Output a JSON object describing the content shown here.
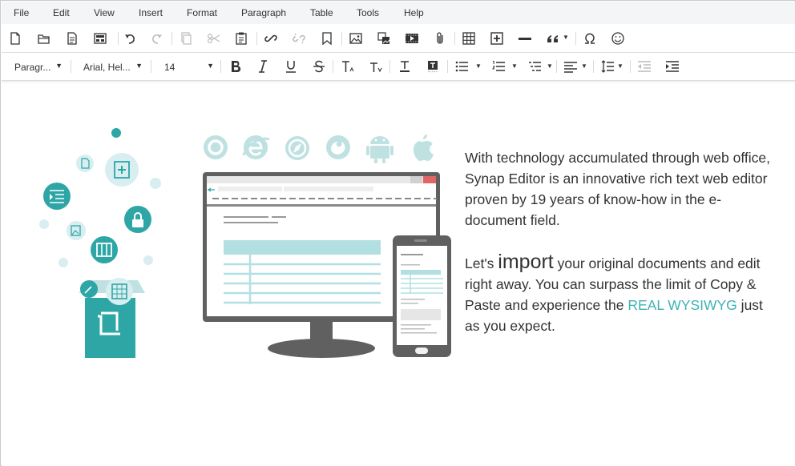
{
  "menu": {
    "items": [
      "File",
      "Edit",
      "View",
      "Insert",
      "Format",
      "Paragraph",
      "Table",
      "Tools",
      "Help"
    ]
  },
  "toolbar2": {
    "paragraph_style": "Paragr...",
    "font_family": "Arial, Hel...",
    "font_size": "14"
  },
  "icons": {
    "new": "new-document-icon",
    "open": "open-folder-icon",
    "template": "template-icon",
    "layout": "page-layout-icon",
    "undo": "undo-icon",
    "redo": "redo-icon",
    "copy": "copy-icon",
    "cut": "cut-icon",
    "paste": "paste-icon",
    "link": "link-icon",
    "unlink": "unlink-icon",
    "bookmark": "bookmark-icon",
    "image": "image-icon",
    "bg_image": "background-image-icon",
    "video": "video-icon",
    "attach": "attach-icon",
    "table": "table-icon",
    "div": "insert-div-icon",
    "hr": "horizontal-rule-icon",
    "quote": "quote-icon",
    "special_char": "omega-icon",
    "emoji": "emoji-icon"
  },
  "content": {
    "paragraph1": "With technology accumulated through web office, Synap Editor is an innovative rich text web editor proven by 19 years of know-how in the e-document field.",
    "paragraph2_start": "Let's ",
    "paragraph2_big": "import",
    "paragraph2_mid": " your original documents and edit right away. You can surpass the limit of Copy & Paste and experience the ",
    "paragraph2_accent": "REAL WYSIWYG",
    "paragraph2_end": " just as you expect."
  },
  "colors": {
    "accent": "#3fb2b2",
    "teal_dark": "#2ea6a6",
    "teal_light": "#d8eef0",
    "monitor": "#606060"
  }
}
